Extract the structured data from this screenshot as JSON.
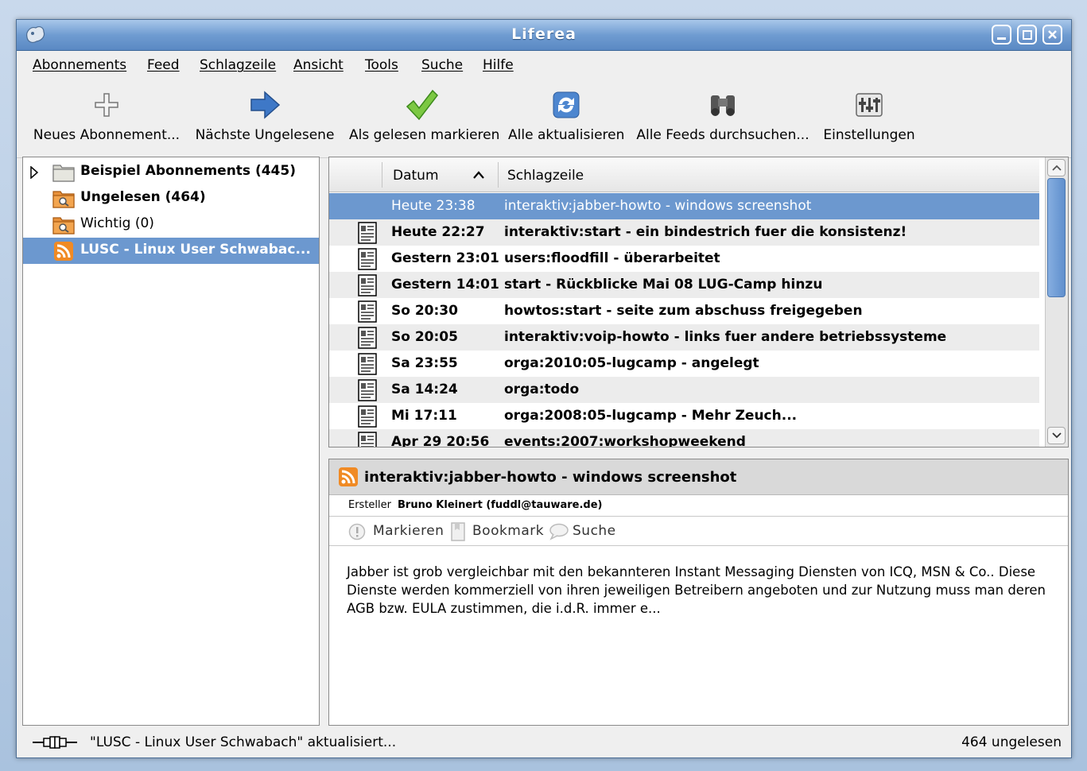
{
  "window": {
    "title": "Liferea"
  },
  "menu": [
    "Abonnements",
    "Feed",
    "Schlagzeile",
    "Ansicht",
    "Tools",
    "Suche",
    "Hilfe"
  ],
  "toolbar": {
    "new_subscription": "Neues Abonnement...",
    "next_unread": "Nächste Ungelesene",
    "mark_read": "Als gelesen markieren",
    "update_all": "Alle aktualisieren",
    "search_all": "Alle Feeds durchsuchen...",
    "settings": "Einstellungen"
  },
  "feeds": [
    {
      "label": "Beispiel Abonnements (445)",
      "icon": "folder-icon",
      "bold": true
    },
    {
      "label": "Ungelesen (464)",
      "icon": "search-folder-icon",
      "bold": true
    },
    {
      "label": "Wichtig (0)",
      "icon": "search-folder-icon",
      "bold": false
    },
    {
      "label": "LUSC - Linux User Schwabac...",
      "icon": "rss-icon",
      "bold": true,
      "selected": true
    }
  ],
  "list": {
    "col_date": "Datum",
    "col_headline": "Schlagzeile",
    "rows": [
      {
        "date": "Heute 23:38",
        "headline": "interaktiv:jabber-howto - windows screenshot",
        "selected": true
      },
      {
        "date": "Heute 22:27",
        "headline": "interaktiv:start - ein bindestrich fuer die konsistenz!"
      },
      {
        "date": "Gestern 23:01",
        "headline": "users:floodfill - überarbeitet"
      },
      {
        "date": "Gestern 14:01",
        "headline": "start - Rückblicke Mai 08 LUG-Camp hinzu"
      },
      {
        "date": "So 20:30",
        "headline": "howtos:start - seite zum abschuss freigegeben"
      },
      {
        "date": "So 20:05",
        "headline": "interaktiv:voip-howto - links fuer andere betriebssysteme"
      },
      {
        "date": "Sa 23:55",
        "headline": "orga:2010:05-lugcamp - angelegt"
      },
      {
        "date": "Sa 14:24",
        "headline": "orga:todo"
      },
      {
        "date": "Mi 17:11",
        "headline": "orga:2008:05-lugcamp - Mehr Zeuch..."
      },
      {
        "date": "Apr 29 20:56",
        "headline": "events:2007:workshopweekend"
      }
    ]
  },
  "article": {
    "title": "interaktiv:jabber-howto - windows screenshot",
    "author_label": "Ersteller",
    "author": "Bruno Kleinert (fuddl@tauware.de)",
    "action_mark": "Markieren",
    "action_bookmark": "Bookmark",
    "action_search": "Suche",
    "body": "Jabber ist grob vergleichbar mit den bekannteren Instant Messaging Diensten von ICQ, MSN & Co.. Diese Dienste werden kommerziell von ihren jeweiligen Betreibern angeboten und zur Nutzung muss man deren AGB bzw. EULA zustimmen, die i.d.R. immer e..."
  },
  "status": {
    "left": "\"LUSC - Linux User Schwabach\" aktualisiert...",
    "right": "464 ungelesen"
  },
  "colors": {
    "selection": "#6c98cf",
    "title_bar": "#6f9cd1",
    "rss": "#f08a24"
  }
}
